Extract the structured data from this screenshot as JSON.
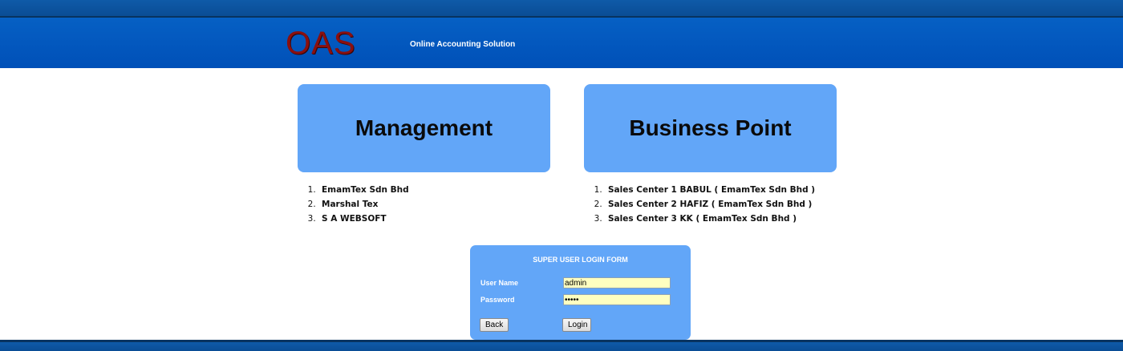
{
  "header": {
    "logo": "OAS",
    "tagline": "Online Accounting Solution"
  },
  "management": {
    "title": "Management",
    "items": [
      "EmamTex Sdn Bhd",
      "Marshal Tex",
      "S A WEBSOFT"
    ]
  },
  "business_point": {
    "title": "Business Point",
    "items": [
      "Sales Center 1 BABUL ( EmamTex Sdn Bhd )",
      "Sales Center 2 HAFIZ ( EmamTex Sdn Bhd )",
      "Sales Center 3 KK ( EmamTex Sdn Bhd )"
    ]
  },
  "login_form": {
    "title": "SUPER USER LOGIN FORM",
    "username_label": "User Name",
    "username_value": "admin",
    "password_label": "Password",
    "password_value": "admin",
    "back_label": "Back",
    "login_label": "Login"
  },
  "colors": {
    "header_blue": "#0660c4",
    "panel_blue": "#62a6f8",
    "logo_red": "#8a1010",
    "input_bg": "#ffffc0"
  }
}
